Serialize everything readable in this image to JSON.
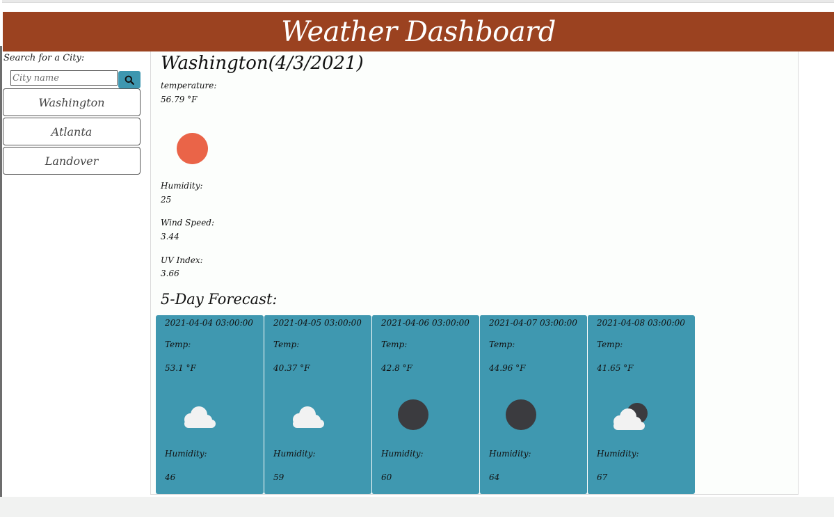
{
  "header": {
    "title": "Weather Dashboard"
  },
  "search": {
    "label": "Search for a City:",
    "placeholder": "City name"
  },
  "history": [
    {
      "label": "Washington"
    },
    {
      "label": "Atlanta"
    },
    {
      "label": "Landover"
    }
  ],
  "current": {
    "title": "Washington(4/3/2021)",
    "temp_label": "temperature:",
    "temp_value": "56.79 °F",
    "icon": "clear-sun-icon",
    "humidity_label": "Humidity:",
    "humidity_value": "25",
    "wind_label": "Wind Speed:",
    "wind_value": "3.44",
    "uv_label": "UV Index:",
    "uv_value": "3.66"
  },
  "forecast": {
    "title": "5-Day Forecast:",
    "days": [
      {
        "date": "2021-04-04 03:00:00",
        "temp_label": "Temp:",
        "temp": "53.1 °F",
        "icon": "cloud-icon",
        "humidity_label": "Humidity:",
        "humidity": "46"
      },
      {
        "date": "2021-04-05 03:00:00",
        "temp_label": "Temp:",
        "temp": "40.37 °F",
        "icon": "cloud-icon",
        "humidity_label": "Humidity:",
        "humidity": "59"
      },
      {
        "date": "2021-04-06 03:00:00",
        "temp_label": "Temp:",
        "temp": "42.8 °F",
        "icon": "clear-night-icon",
        "humidity_label": "Humidity:",
        "humidity": "60"
      },
      {
        "date": "2021-04-07 03:00:00",
        "temp_label": "Temp:",
        "temp": "44.96 °F",
        "icon": "clear-night-icon",
        "humidity_label": "Humidity:",
        "humidity": "64"
      },
      {
        "date": "2021-04-08 03:00:00",
        "temp_label": "Temp:",
        "temp": "41.65 °F",
        "icon": "partly-cloudy-night-icon",
        "humidity_label": "Humidity:",
        "humidity": "67"
      }
    ]
  },
  "colors": {
    "header_bg": "#9b4220",
    "accent": "#3f98b0",
    "sun": "#ea6448",
    "moon": "#3b3b3f",
    "cloud": "#f2f2f2"
  }
}
